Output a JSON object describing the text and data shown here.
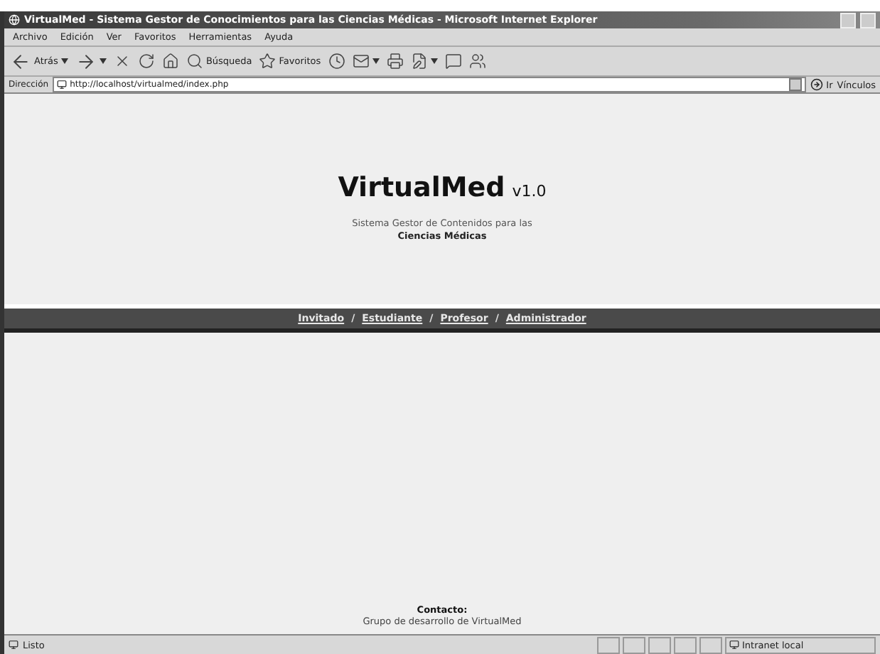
{
  "window": {
    "title": "VirtualMed - Sistema Gestor de Conocimientos para las Ciencias Médicas - Microsoft Internet Explorer"
  },
  "menu": [
    "Archivo",
    "Edición",
    "Ver",
    "Favoritos",
    "Herramientas",
    "Ayuda"
  ],
  "toolbar": [
    {
      "label": "Atrás",
      "dropdown": true
    },
    {
      "dropdown": true
    },
    {
      "dropdown": false
    },
    {
      "dropdown": false
    },
    {
      "dropdown": false
    },
    {
      "label": "Búsqueda",
      "dropdown": false
    },
    {
      "label": "Favoritos",
      "dropdown": false
    },
    {
      "dropdown": false
    },
    {
      "dropdown": true
    },
    {
      "dropdown": false
    },
    {
      "dropdown": true
    },
    {
      "dropdown": false
    },
    {
      "dropdown": false
    }
  ],
  "address": {
    "label": "Dirección",
    "value": "http://localhost/virtualmed/index.php",
    "go": "Ir",
    "links": "Vínculos"
  },
  "header": {
    "title": "VirtualMed",
    "version": "v1.0",
    "subtitle": "Sistema Gestor de Contenidos para las",
    "subtitle_bold": "Ciencias Médicas"
  },
  "nav": {
    "separator": "/",
    "links": [
      "Invitado",
      "Estudiante",
      "Profesor",
      "Administrador"
    ]
  },
  "footer": {
    "heading": "Contacto:",
    "text": "Grupo de desarrollo de VirtualMed"
  },
  "status_bar": {
    "text": "Listo",
    "zone": "Intranet local"
  }
}
